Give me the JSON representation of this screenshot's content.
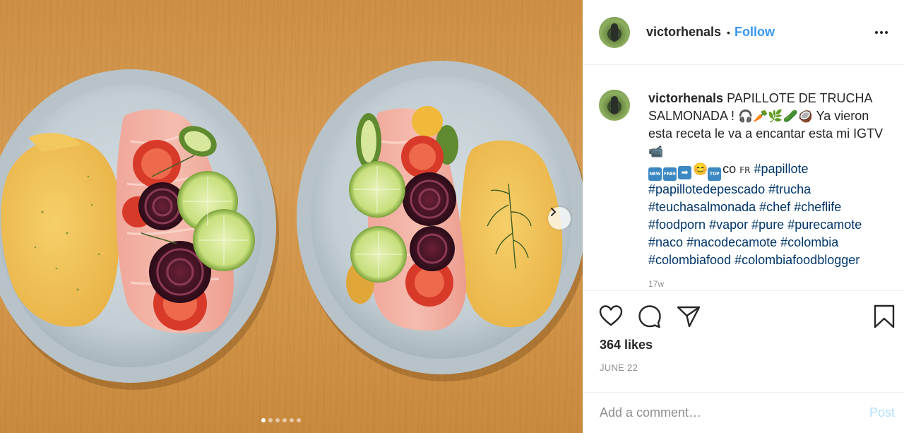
{
  "photo": {
    "alt_name": "food-photo",
    "carousel": {
      "count": 6,
      "active": 0
    }
  },
  "header": {
    "username": "victorhenals",
    "separator": "•",
    "follow_label": "Follow"
  },
  "caption": {
    "username": "victorhenals",
    "text_part1": "PAPILLOTE DE TRUCHA SALMONADA !",
    "emojis1": "🎧🥕🌿🥒🥥",
    "text_part2": "Ya vieron esta receta le va a encantar esta mi IGTV",
    "emoji_camera": "📹",
    "box_new": "NEW",
    "box_free": "FREE",
    "box_arrow": "➡",
    "emoji_smile": "😊",
    "box_top": "TOP",
    "text_co": "co",
    "text_fr": "FR",
    "hashtags": [
      "#papillote",
      "#papillotedepescado",
      "#trucha",
      "#teuchasalmonada",
      "#chef",
      "#cheflife",
      "#foodporn",
      "#vapor",
      "#pure",
      "#purecamote",
      "#naco",
      "#nacodecamote",
      "#colombia",
      "#colombiafood",
      "#colombiafoodblogger"
    ],
    "time_cut": "17w"
  },
  "actions": {
    "likes": "364 likes",
    "date": "JUNE 22"
  },
  "comment": {
    "placeholder": "Add a comment…",
    "post_label": "Post"
  },
  "colors": {
    "link": "#3897f0",
    "hashtag": "#003569",
    "muted": "#8e8e8e",
    "post_disabled": "#b2dffc"
  }
}
